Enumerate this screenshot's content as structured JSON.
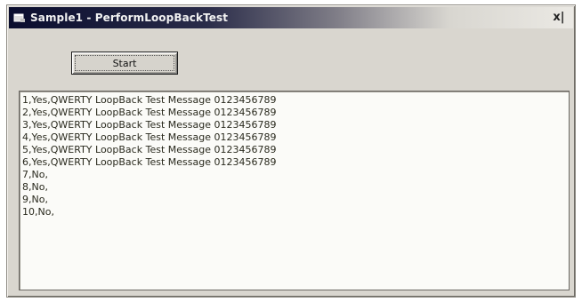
{
  "window": {
    "title": "Sample1 - PerformLoopBackTest",
    "close_label": "x|"
  },
  "icons": {
    "app": "app-window-icon",
    "close": "close-icon"
  },
  "controls": {
    "start_label": "Start"
  },
  "output": {
    "lines": [
      "1,Yes,QWERTY LoopBack Test Message 0123456789",
      "2,Yes,QWERTY LoopBack Test Message 0123456789",
      "3,Yes,QWERTY LoopBack Test Message 0123456789",
      "4,Yes,QWERTY LoopBack Test Message 0123456789",
      "5,Yes,QWERTY LoopBack Test Message 0123456789",
      "6,Yes,QWERTY LoopBack Test Message 0123456789",
      "7,No,",
      "8,No,",
      "9,No,",
      "10,No,"
    ]
  },
  "colors": {
    "title_bar_start": "#0a0d2e",
    "title_bar_end": "#ebe9e4",
    "window_face": "#d9d6cf",
    "text_area_bg": "#fbfbf8"
  }
}
